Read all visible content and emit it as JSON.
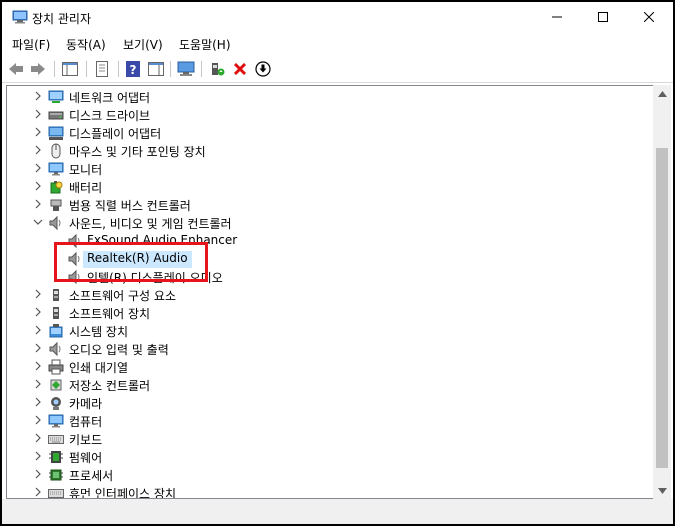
{
  "window": {
    "title": "장치 관리자",
    "minimize_glyph": "—",
    "maximize_glyph": "☐",
    "close_glyph": "✕"
  },
  "menu": [
    "파일(F)",
    "동작(A)",
    "보기(V)",
    "도움말(H)"
  ],
  "tree": {
    "items": [
      {
        "label": "네트워크 어댑터",
        "icon": "network-adapter-icon",
        "expanded": false
      },
      {
        "label": "디스크 드라이브",
        "icon": "disk-drive-icon",
        "expanded": false
      },
      {
        "label": "디스플레이 어댑터",
        "icon": "display-adapter-icon",
        "expanded": false
      },
      {
        "label": "마우스 및 기타 포인팅 장치",
        "icon": "mouse-icon",
        "expanded": false
      },
      {
        "label": "모니터",
        "icon": "monitor-icon",
        "expanded": false
      },
      {
        "label": "배터리",
        "icon": "battery-icon",
        "expanded": false
      },
      {
        "label": "범용 직렬 버스 컨트롤러",
        "icon": "usb-icon",
        "expanded": false
      },
      {
        "label": "사운드, 비디오 및 게임 컨트롤러",
        "icon": "speaker-icon",
        "expanded": true
      },
      {
        "label": "FxSound Audio Enhancer",
        "icon": "speaker-icon",
        "child": true
      },
      {
        "label": "Realtek(R) Audio",
        "icon": "speaker-icon",
        "child": true,
        "selected": true
      },
      {
        "label": "인텔(R) 디스플레이 오디오",
        "icon": "speaker-icon",
        "child": true
      },
      {
        "label": "소프트웨어 구성 요소",
        "icon": "software-component-icon",
        "expanded": false
      },
      {
        "label": "소프트웨어 장치",
        "icon": "software-device-icon",
        "expanded": false
      },
      {
        "label": "시스템 장치",
        "icon": "system-device-icon",
        "expanded": false
      },
      {
        "label": "오디오 입력 및 출력",
        "icon": "audio-io-icon",
        "expanded": false
      },
      {
        "label": "인쇄 대기열",
        "icon": "printer-icon",
        "expanded": false
      },
      {
        "label": "저장소 컨트롤러",
        "icon": "storage-controller-icon",
        "expanded": false
      },
      {
        "label": "카메라",
        "icon": "camera-icon",
        "expanded": false
      },
      {
        "label": "컴퓨터",
        "icon": "computer-icon",
        "expanded": false
      },
      {
        "label": "키보드",
        "icon": "keyboard-icon",
        "expanded": false
      },
      {
        "label": "펌웨어",
        "icon": "firmware-icon",
        "expanded": false
      },
      {
        "label": "프로세서",
        "icon": "processor-icon",
        "expanded": false
      },
      {
        "label": "휴먼 인터페이스 장치",
        "icon": "hid-icon",
        "expanded": false
      }
    ]
  },
  "colors": {
    "highlight_box": "#e8141c",
    "selection": "#cce8ff"
  }
}
